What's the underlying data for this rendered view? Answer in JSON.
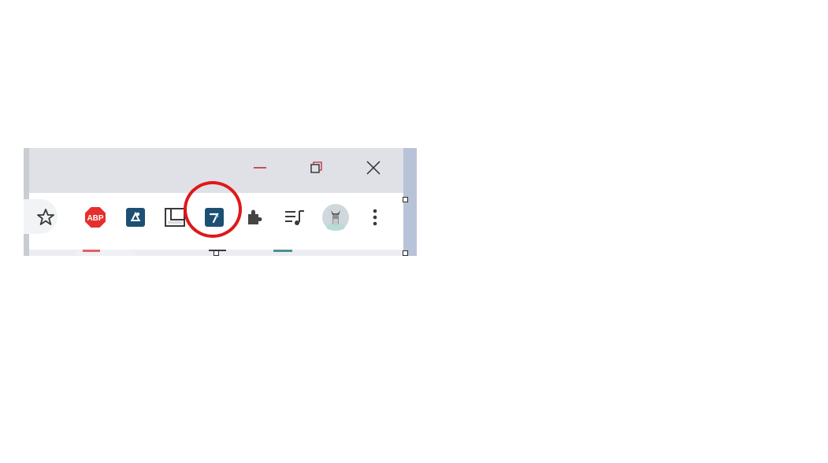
{
  "window_controls": {
    "minimize": "minimize-icon",
    "restore": "restore-icon",
    "close": "close-icon"
  },
  "toolbar": {
    "icons": [
      {
        "name": "bookmark-star-icon"
      },
      {
        "name": "adblock-plus-icon",
        "label": "ABP"
      },
      {
        "name": "extension-blue-icon"
      },
      {
        "name": "extension-outline-icon"
      },
      {
        "name": "highlighted-extension-icon"
      },
      {
        "name": "extensions-puzzle-icon"
      },
      {
        "name": "media-queue-icon"
      },
      {
        "name": "profile-avatar"
      },
      {
        "name": "more-menu-icon"
      }
    ]
  },
  "colors": {
    "titlebar": "#dfe1e6",
    "toolbar": "#ffffff",
    "highlight_circle": "#e01818",
    "abp_red": "#e62e2e",
    "extension_blue": "#1d4f73"
  }
}
